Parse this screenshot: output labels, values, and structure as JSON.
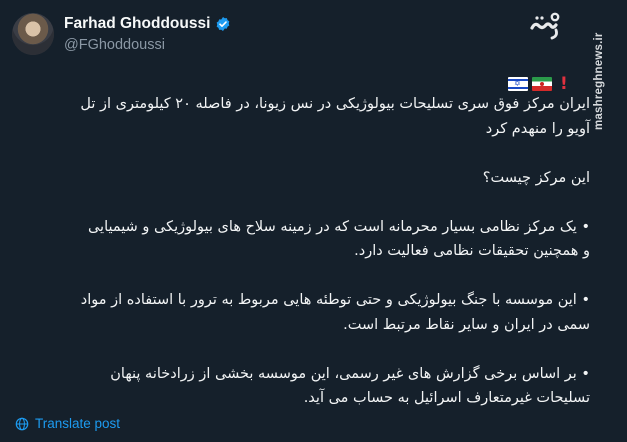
{
  "author": {
    "name": "Farhad Ghoddoussi",
    "handle": "@FGhoddoussi",
    "verified": true
  },
  "watermark": {
    "site": "mashreghnews.ir",
    "logo_text": "مشرق"
  },
  "post": {
    "emoji": [
      "red-exclamation",
      "iran-flag",
      "israel-flag"
    ],
    "lines": [
      "ایران مرکز فوق سری تسلیحات بیولوژیکی در نس زیونا، در فاصله ۲۰ کیلومتری از تل",
      "آویو را منهدم کرد",
      "",
      "این مرکز چیست؟",
      "",
      "• یک مرکز نظامی بسیار محرمانه است که در زمینه سلاح های بیولوژیکی و شیمیایی",
      "و همچنین تحقیقات نظامی فعالیت دارد.",
      "",
      "• این موسسه با جنگ بیولوژیکی و حتی توطئه هایی مربوط به ترور با استفاده از مواد",
      "سمی در ایران و سایر نقاط مرتبط است.",
      "",
      "• بر اساس برخی گزارش های غیر رسمی، این موسسه بخشی از زرادخانه پنهان",
      "تسلیحات غیرمتعارف اسرائیل به حساب می آید."
    ]
  },
  "actions": {
    "translate_label": "Translate post"
  },
  "colors": {
    "background": "#15202b",
    "text": "#f7f9f9",
    "secondary": "#8b98a5",
    "link": "#1d9bf0",
    "verified": "#1d9bf0"
  }
}
